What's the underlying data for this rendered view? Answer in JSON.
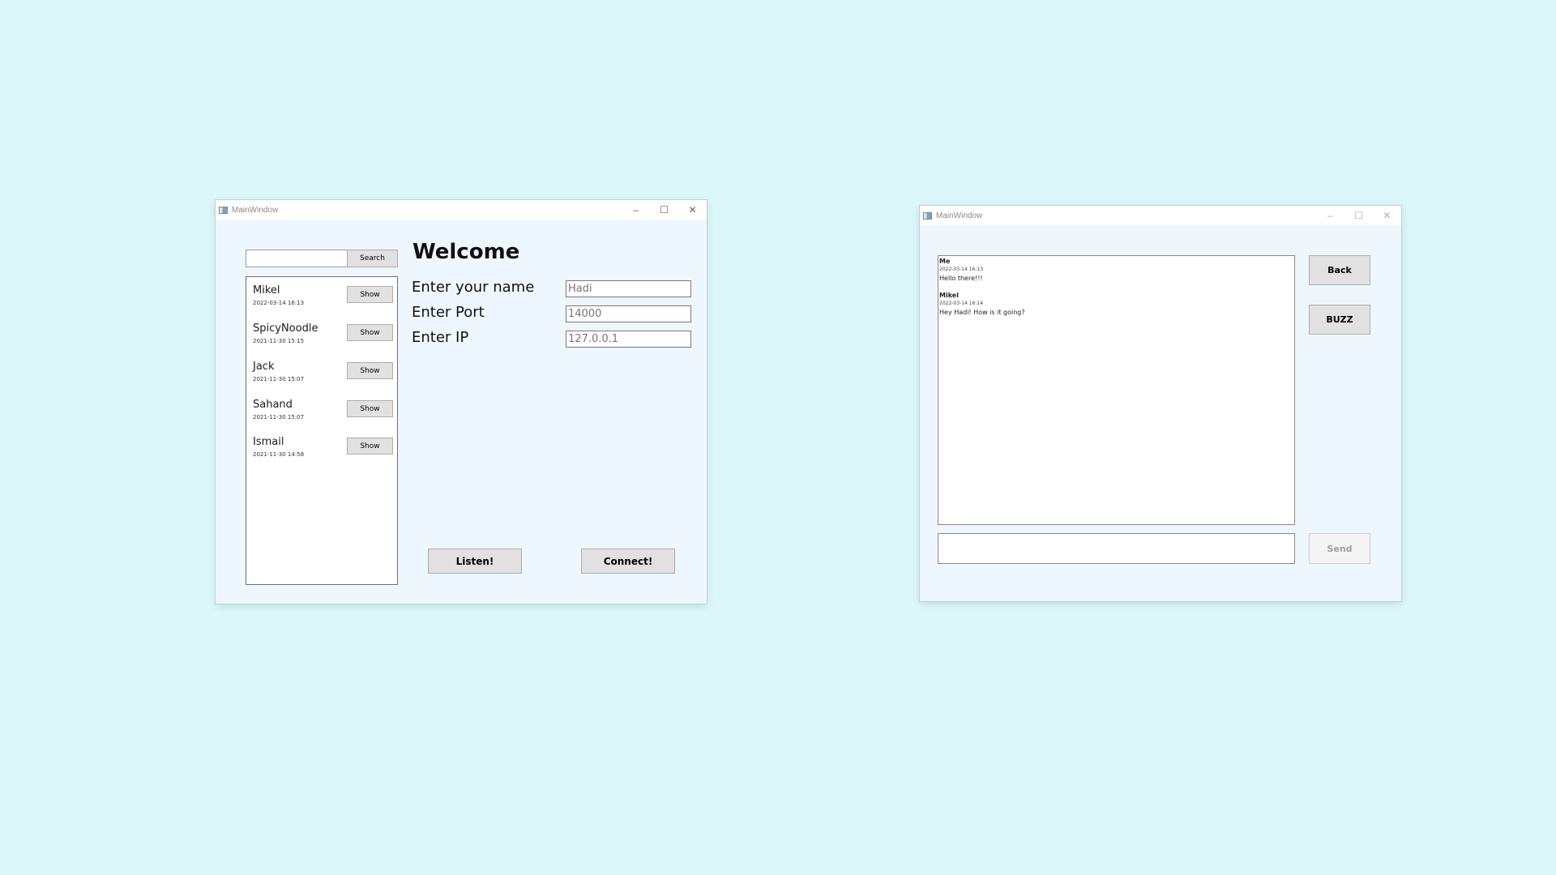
{
  "window_left": {
    "title": "MainWindow",
    "controls": {
      "minimize": "–",
      "maximize": "☐",
      "close": "✕"
    },
    "search": {
      "value": "",
      "button_label": "Search"
    },
    "contacts": [
      {
        "name": "Mikel",
        "date": "2022-03-14 16:13",
        "button": "Show"
      },
      {
        "name": "SpicyNoodle",
        "date": "2021-11-30 15:15",
        "button": "Show"
      },
      {
        "name": "Jack",
        "date": "2021-11-30 15:07",
        "button": "Show"
      },
      {
        "name": "Sahand",
        "date": "2021-11-30 15:07",
        "button": "Show"
      },
      {
        "name": "Ismail",
        "date": "2021-11-30 14:58",
        "button": "Show"
      }
    ],
    "heading": "Welcome",
    "form": {
      "name_label": "Enter your name",
      "name_value": "Hadi",
      "port_label": "Enter Port",
      "port_value": "14000",
      "ip_label": "Enter IP",
      "ip_value": "127.0.0.1"
    },
    "listen_label": "Listen!",
    "connect_label": "Connect!"
  },
  "window_right": {
    "title": "MainWindow",
    "controls": {
      "minimize": "–",
      "maximize": "☐",
      "close": "✕"
    },
    "messages": [
      {
        "author": "Me",
        "date": "2022-03-14 16:13",
        "text": "Hello there!!!"
      },
      {
        "author": "Mikel",
        "date": "2022-03-14 16:14",
        "text": "Hey Hadi! How is it going?"
      }
    ],
    "back_label": "Back",
    "buzz_label": "BUZZ",
    "message_input": "",
    "send_label": "Send"
  },
  "icons": {
    "window_icon": "app-window-icon",
    "minimize": "minimize-icon",
    "maximize": "maximize-icon",
    "close": "close-icon"
  }
}
